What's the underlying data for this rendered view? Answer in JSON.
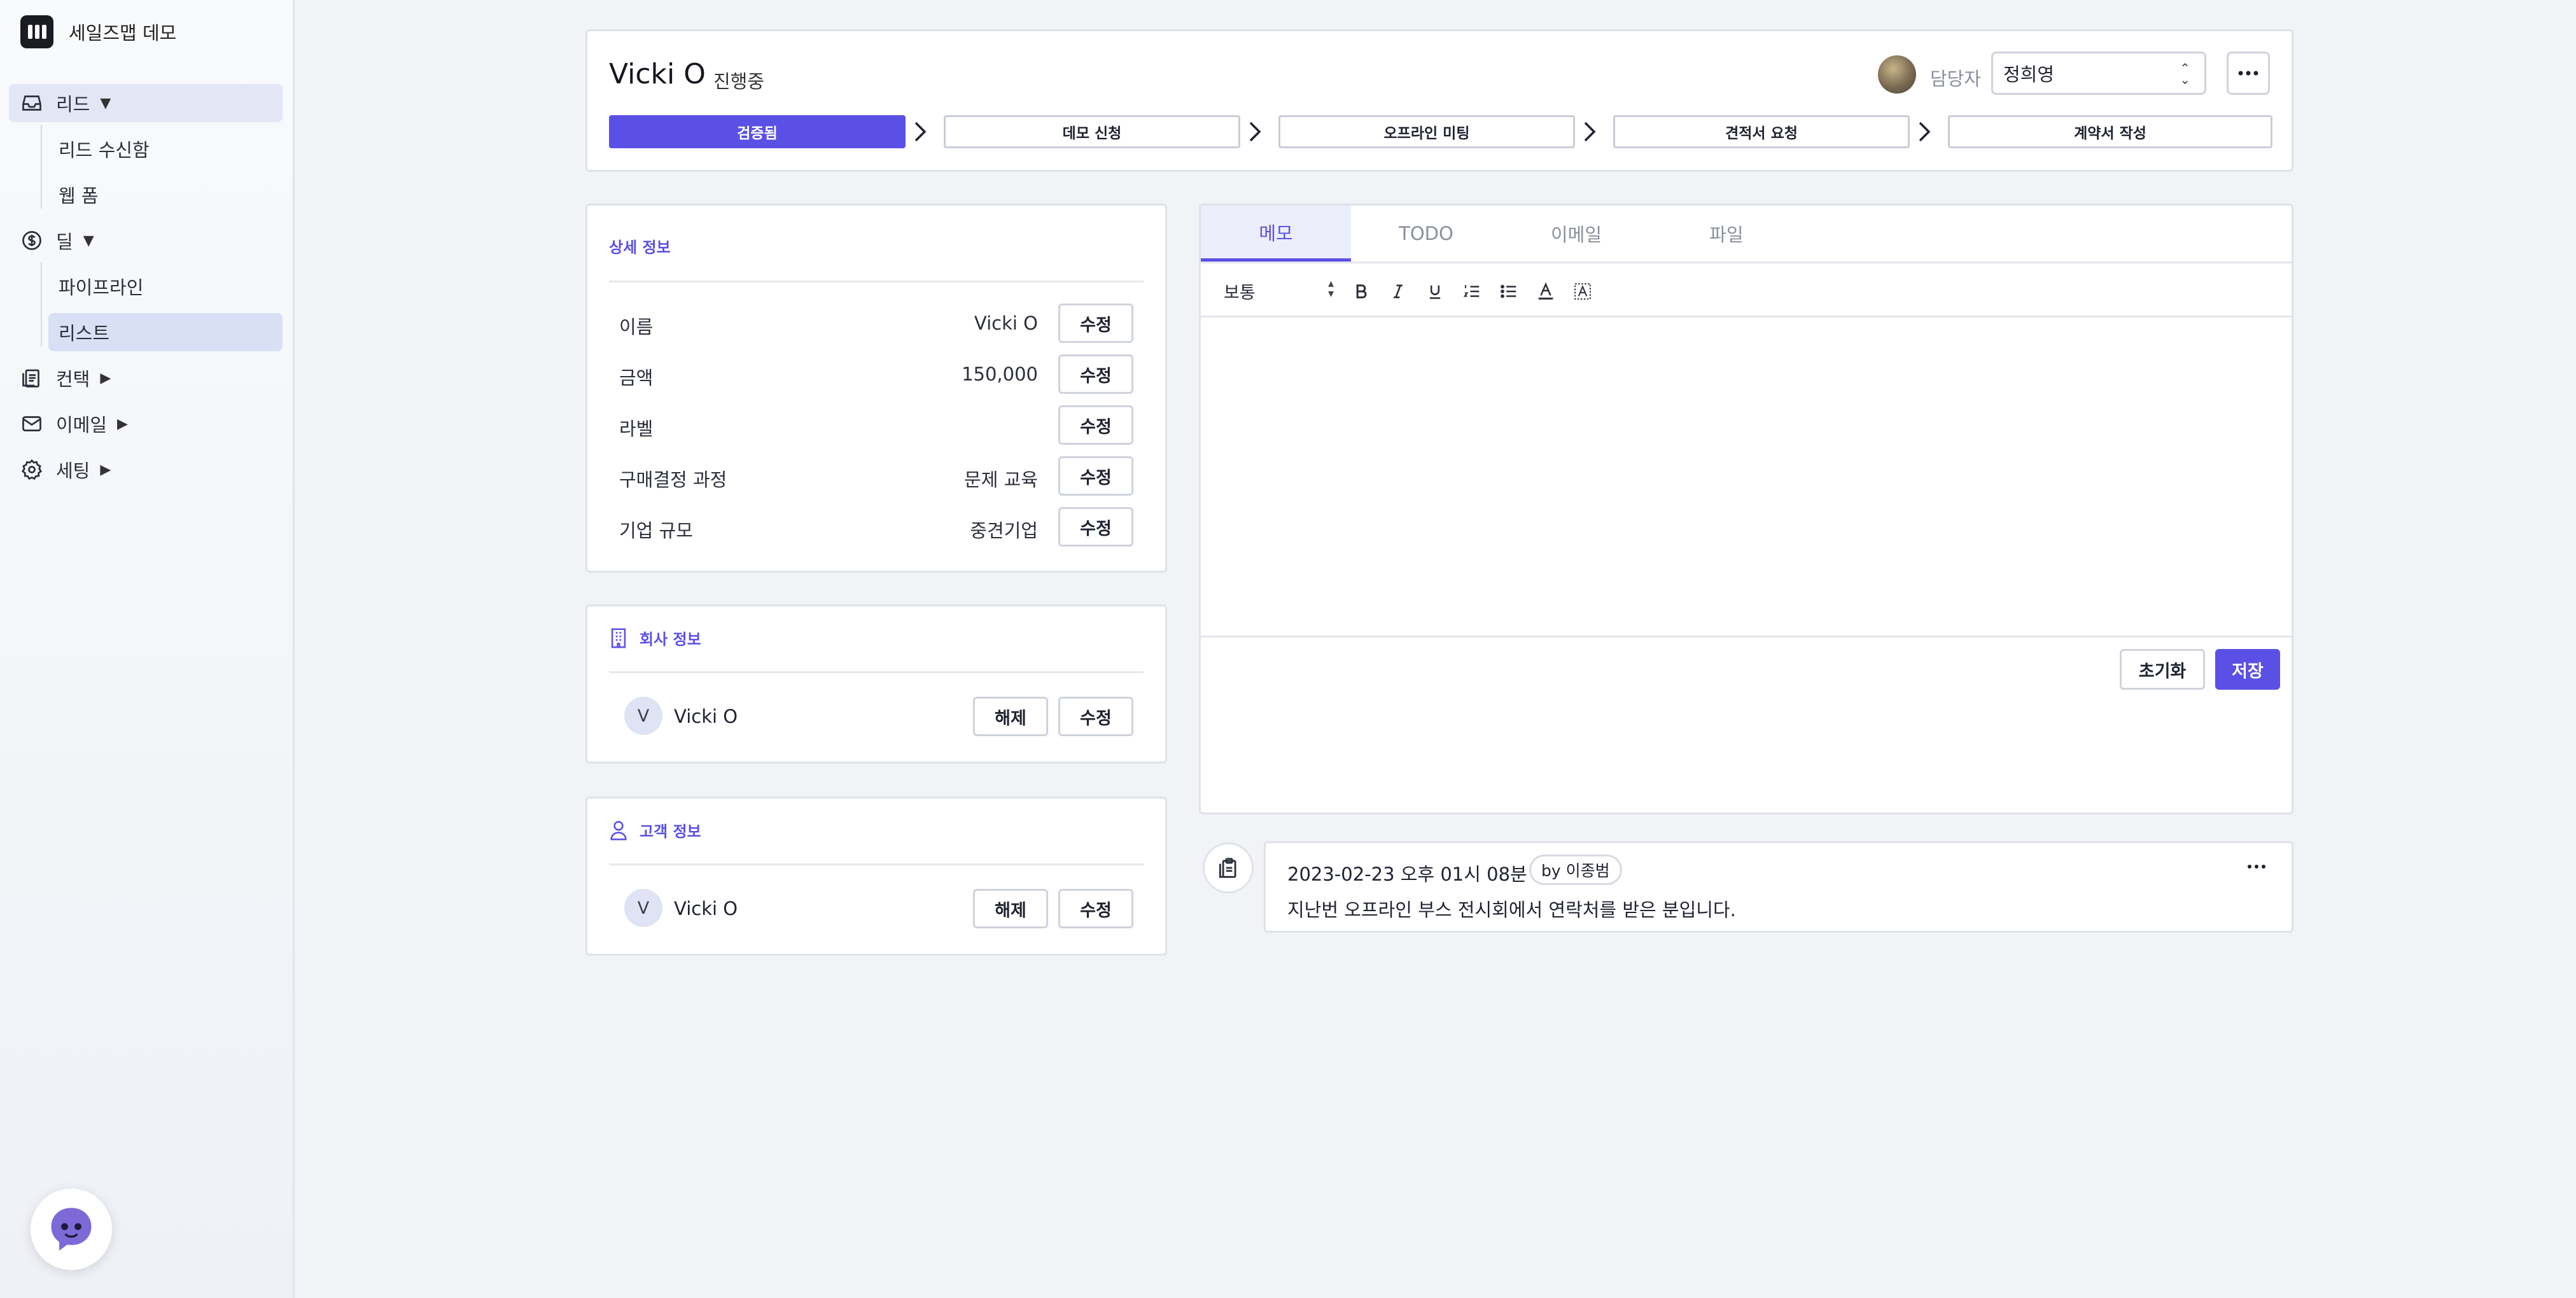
{
  "app": {
    "name": "세일즈맵 데모"
  },
  "sidebar": {
    "lead": {
      "label": "리드",
      "caret": "▼"
    },
    "lead_items": [
      {
        "label": "리드 수신함"
      },
      {
        "label": "웹 폼"
      }
    ],
    "deal": {
      "label": "딜",
      "caret": "▼"
    },
    "deal_items": [
      {
        "label": "파이프라인"
      },
      {
        "label": "리스트"
      }
    ],
    "contact": {
      "label": "컨택",
      "caret": "▶"
    },
    "email": {
      "label": "이메일",
      "caret": "▶"
    },
    "settings": {
      "label": "세팅",
      "caret": "▶"
    }
  },
  "header": {
    "title": "Vicki O",
    "status": "진행중",
    "assignee_label": "담당자",
    "assignee_value": "정희영"
  },
  "pipeline": {
    "stages": [
      {
        "label": "검증됨",
        "active": true
      },
      {
        "label": "데모 신청",
        "active": false
      },
      {
        "label": "오프라인 미팅",
        "active": false
      },
      {
        "label": "견적서 요청",
        "active": false
      },
      {
        "label": "계약서 작성",
        "active": false
      }
    ]
  },
  "details": {
    "title": "상세 정보",
    "edit_label": "수정",
    "rows": [
      {
        "label": "이름",
        "value": "Vicki O"
      },
      {
        "label": "금액",
        "value": "150,000"
      },
      {
        "label": "라벨",
        "value": ""
      },
      {
        "label": "구매결정 과정",
        "value": "문제 교육"
      },
      {
        "label": "기업 규모",
        "value": "중견기업"
      }
    ]
  },
  "company": {
    "title": "회사 정보",
    "avatar_initial": "V",
    "name": "Vicki O",
    "unlink_label": "해제",
    "edit_label": "수정"
  },
  "customer": {
    "title": "고객 정보",
    "avatar_initial": "V",
    "name": "Vicki O",
    "unlink_label": "해제",
    "edit_label": "수정"
  },
  "tabs": [
    {
      "label": "메모",
      "active": true
    },
    {
      "label": "TODO",
      "active": false
    },
    {
      "label": "이메일",
      "active": false
    },
    {
      "label": "파일",
      "active": false
    }
  ],
  "editor": {
    "format_select": "보통",
    "reset_label": "초기화",
    "save_label": "저장"
  },
  "memo": {
    "date": "2023-02-23 오후 01시 08분",
    "author": "by 이종범",
    "text": "지난번 오프라인 부스 전시회에서 연락처를 받은 분입니다."
  },
  "colors": {
    "accent": "#5b50e6",
    "background": "#f2f3f6",
    "border": "#dfe2e8"
  }
}
